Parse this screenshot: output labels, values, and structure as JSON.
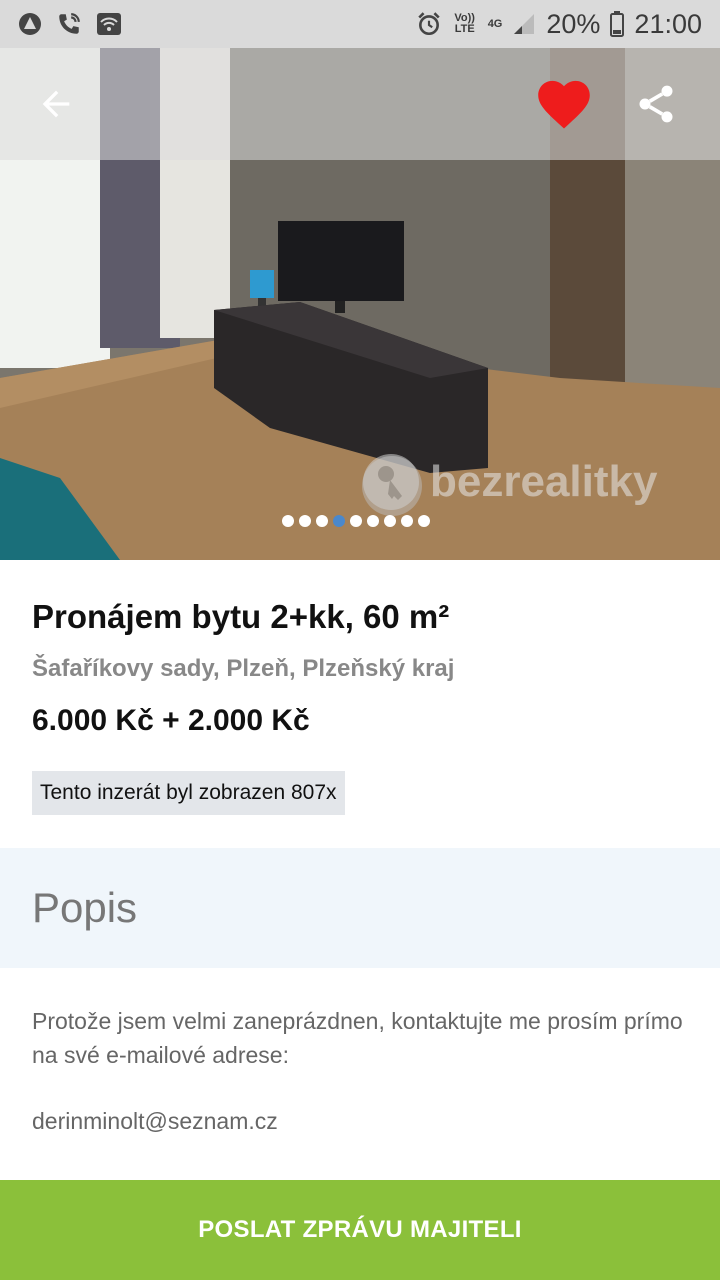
{
  "status_bar": {
    "volte": "Vo)) LTE",
    "network": "4G",
    "battery": "20%",
    "time": "21:00"
  },
  "hero": {
    "watermark": "bezrealitky",
    "gallery_total": 9,
    "gallery_active_index": 4
  },
  "icons": {
    "back": "arrow-left-icon",
    "favorite": "heart-icon",
    "share": "share-icon"
  },
  "colors": {
    "favorite": "#ee1c1c",
    "action_button": "#8bc03a",
    "active_dot": "#4a88cc"
  },
  "listing": {
    "title": "Pronájem bytu 2+kk, 60 m²",
    "location": "Šafaříkovy sady, Plzeň, Plzeňský kraj",
    "price": "6.000 Kč + 2.000 Kč",
    "views": "Tento inzerát byl zobrazen 807x"
  },
  "description": {
    "heading": "Popis",
    "text": "Protože jsem velmi zaneprázdnen, kontaktujte me prosím prímo na své e-mailové adrese:",
    "email": "derinminolt@seznam.cz"
  },
  "action": {
    "send_label": "POSLAT ZPRÁVU MAJITELI"
  }
}
